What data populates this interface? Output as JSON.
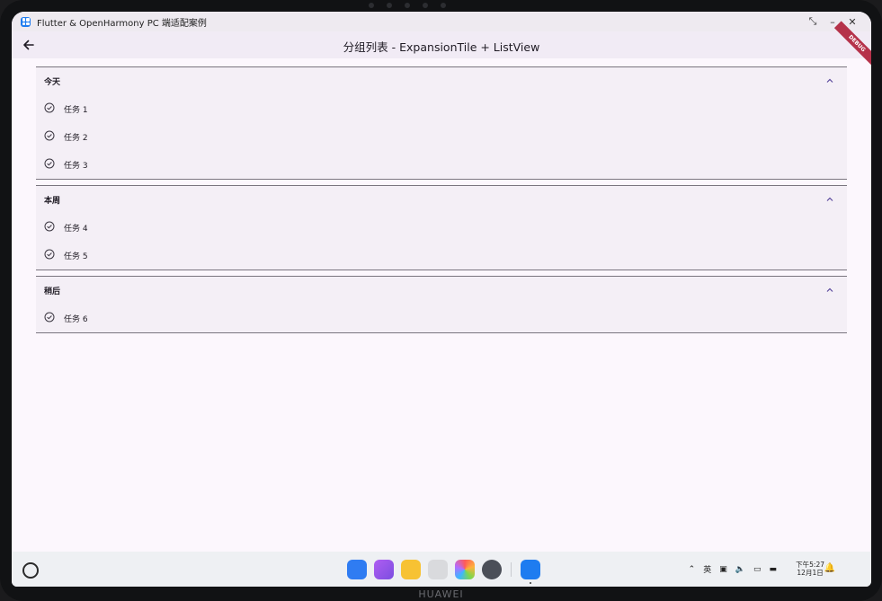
{
  "window": {
    "title": "Flutter & OpenHarmony PC 端适配案例",
    "controls": [
      "⤡",
      "–",
      "✕"
    ]
  },
  "appbar": {
    "title": "分组列表 - ExpansionTile + ListView",
    "back_icon": "arrow-back-icon",
    "debug_banner": "DEBUG"
  },
  "groups": [
    {
      "title": "今天",
      "tasks": [
        "任务 1",
        "任务 2",
        "任务 3"
      ],
      "expanded": true
    },
    {
      "title": "本周",
      "tasks": [
        "任务 4",
        "任务 5"
      ],
      "expanded": true
    },
    {
      "title": "稍后",
      "tasks": [
        "任务 6"
      ],
      "expanded": true
    }
  ],
  "taskbar": {
    "dock_apps": [
      "app-grid",
      "multitask",
      "files",
      "trash",
      "gallery",
      "settings",
      "flutter-app"
    ],
    "clock_time": "下午5:27",
    "clock_date": "12月1日",
    "tray_input": "英"
  },
  "device": {
    "brand": "HUAWEI"
  },
  "colors": {
    "accent": "#5b4a9e",
    "background": "#fcf7fd",
    "group_bg": "#f4eff6",
    "appbar_bg": "#f1ebf5"
  }
}
